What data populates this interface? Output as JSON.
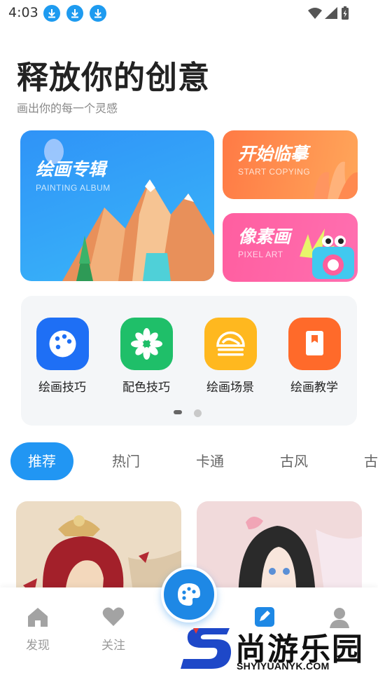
{
  "status_bar": {
    "time": "4:03"
  },
  "header": {
    "title": "释放你的创意",
    "subtitle": "画出你的每一个灵感"
  },
  "banners": {
    "album": {
      "title": "绘画专辑",
      "subtitle": "PAINTING ALBUM",
      "color": "#2f93f7"
    },
    "copy": {
      "title": "开始临摹",
      "subtitle": "START COPYING",
      "color": "#ff7a45"
    },
    "pixel": {
      "title": "像素画",
      "subtitle": "PIXEL ART",
      "color": "#ff5ea0"
    }
  },
  "tools": [
    {
      "label": "绘画技巧",
      "icon": "palette-icon",
      "color": "#1e6ff5"
    },
    {
      "label": "配色技巧",
      "icon": "flower-icon",
      "color": "#1fbf69"
    },
    {
      "label": "绘画场景",
      "icon": "sunset-icon",
      "color": "#ffb81f"
    },
    {
      "label": "绘画教学",
      "icon": "book-icon",
      "color": "#ff6a2a"
    }
  ],
  "tabs": [
    {
      "label": "推荐",
      "active": true
    },
    {
      "label": "热门"
    },
    {
      "label": "卡通"
    },
    {
      "label": "古风"
    },
    {
      "label": "古"
    }
  ],
  "bottom_nav": [
    {
      "label": "发现",
      "icon": "home-icon"
    },
    {
      "label": "关注",
      "icon": "heart-icon"
    },
    {
      "label": "",
      "icon": "edit-icon"
    },
    {
      "label": "",
      "icon": "user-icon"
    }
  ],
  "fab": {
    "icon": "palette-icon"
  },
  "watermark": {
    "text": "尚游乐园",
    "url": "SHYIYUANYK.COM"
  },
  "colors": {
    "accent": "#2196f3",
    "nav_inactive": "#9a9a9a"
  }
}
